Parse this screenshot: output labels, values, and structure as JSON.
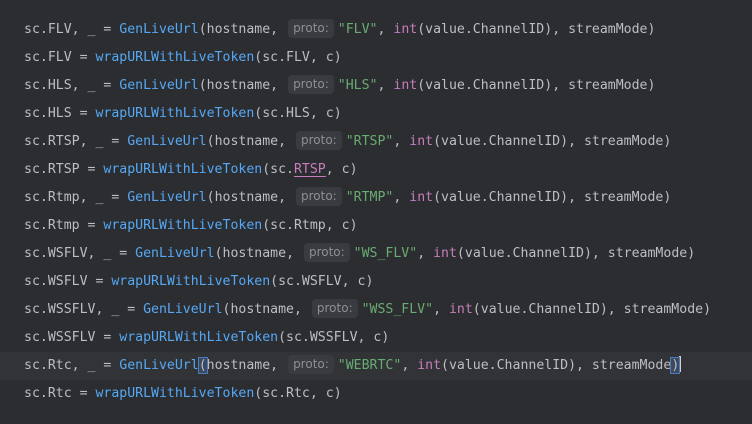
{
  "lines": [
    {
      "v": "sc.FLV",
      "op": ", _ = ",
      "fn": "GenLiveUrl",
      "host": "hostname",
      "hint": "proto:",
      "str": "\"FLV\"",
      "int": "int",
      "arg": "value.ChannelID",
      "mode": "streamMode"
    },
    {
      "v": "sc.FLV",
      "op": " = ",
      "fn": "wrapURLWithLiveToken",
      "arg1": "sc.FLV",
      "arg2": "c"
    },
    {
      "v": "sc.HLS",
      "op": ", _ = ",
      "fn": "GenLiveUrl",
      "host": "hostname",
      "hint": "proto:",
      "str": "\"HLS\"",
      "int": "int",
      "arg": "value.ChannelID",
      "mode": "streamMode"
    },
    {
      "v": "sc.HLS",
      "op": " = ",
      "fn": "wrapURLWithLiveToken",
      "arg1": "sc.HLS",
      "arg2": "c"
    },
    {
      "v": "sc.RTSP",
      "op": ", _ = ",
      "fn": "GenLiveUrl",
      "host": "hostname",
      "hint": "proto:",
      "str": "\"RTSP\"",
      "int": "int",
      "arg": "value.ChannelID",
      "mode": "streamMode"
    },
    {
      "v": "sc.RTSP",
      "op": " = ",
      "fn": "wrapURLWithLiveToken",
      "arg1a": "sc.",
      "arg1b": "RTSP",
      "arg2": "c"
    },
    {
      "v": "sc.Rtmp",
      "op": ", _ = ",
      "fn": "GenLiveUrl",
      "host": "hostname",
      "hint": "proto:",
      "str": "\"RTMP\"",
      "int": "int",
      "arg": "value.ChannelID",
      "mode": "streamMode"
    },
    {
      "v": "sc.Rtmp",
      "op": " = ",
      "fn": "wrapURLWithLiveToken",
      "arg1": "sc.Rtmp",
      "arg2": "c"
    },
    {
      "v": "sc.WSFLV",
      "op": ", _ = ",
      "fn": "GenLiveUrl",
      "host": "hostname",
      "hint": "proto:",
      "str": "\"WS_FLV\"",
      "int": "int",
      "arg": "value.ChannelID",
      "mode": "streamMode"
    },
    {
      "v": "sc.WSFLV",
      "op": " = ",
      "fn": "wrapURLWithLiveToken",
      "arg1": "sc.WSFLV",
      "arg2": "c"
    },
    {
      "v": "sc.WSSFLV",
      "op": ", _ = ",
      "fn": "GenLiveUrl",
      "host": "hostname",
      "hint": "proto:",
      "str": "\"WSS_FLV\"",
      "int": "int",
      "arg": "value.ChannelID",
      "mode": "streamMode"
    },
    {
      "v": "sc.WSSFLV",
      "op": " = ",
      "fn": "wrapURLWithLiveToken",
      "arg1": "sc.WSSFLV",
      "arg2": "c"
    },
    {
      "v": "sc.Rtc",
      "op": ", _ = ",
      "fn": "GenLiveUrl",
      "host": "hostname",
      "hint": "proto:",
      "str": "\"WEBRTC\"",
      "int": "int",
      "arg": "value.ChannelID",
      "mode": "streamMode"
    },
    {
      "v": "sc.Rtc",
      "op": " = ",
      "fn": "wrapURLWithLiveToken",
      "arg1": "sc.Rtc",
      "arg2": "c"
    }
  ],
  "colors": {
    "background": "#2b2d30",
    "current_line": "#313337",
    "function": "#56a8f5",
    "string": "#6aab73",
    "keyword": "#c77dbb",
    "identifier": "#bcbec4",
    "hint_text": "#8c8f94"
  }
}
